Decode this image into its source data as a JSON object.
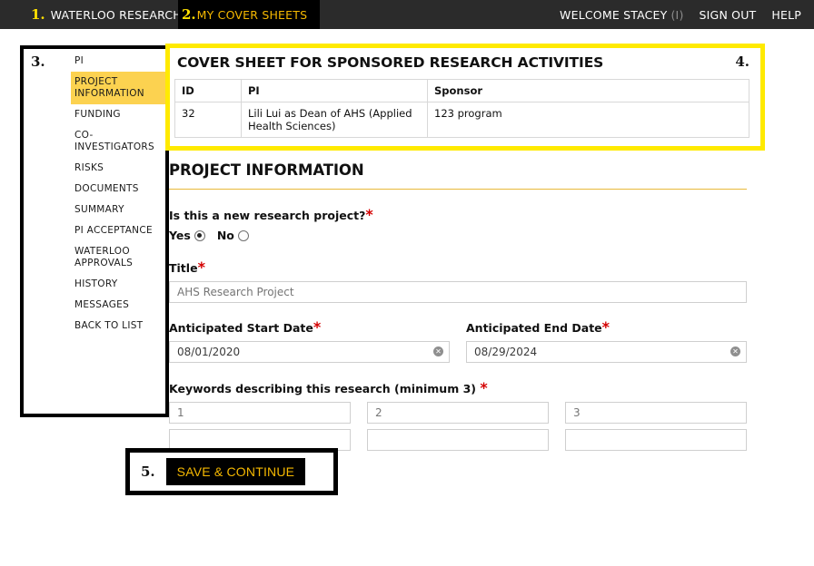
{
  "header": {
    "annotation_1": "1.",
    "brand": "WATERLOO RESEARCH",
    "annotation_2": "2.",
    "tab_cover_sheets": "MY COVER SHEETS",
    "welcome": "WELCOME STACEY",
    "welcome_initial": "(I)",
    "sign_out": "SIGN OUT",
    "help": "HELP"
  },
  "sidebar": {
    "annotation_3": "3.",
    "items": [
      {
        "label": "PI",
        "active": false
      },
      {
        "label": "PROJECT INFORMATION",
        "active": true
      },
      {
        "label": "FUNDING",
        "active": false
      },
      {
        "label": "CO-INVESTIGATORS",
        "active": false
      },
      {
        "label": "RISKS",
        "active": false
      },
      {
        "label": "DOCUMENTS",
        "active": false
      },
      {
        "label": "SUMMARY",
        "active": false
      },
      {
        "label": "PI ACCEPTANCE",
        "active": false
      },
      {
        "label": "WATERLOO APPROVALS",
        "active": false
      },
      {
        "label": "HISTORY",
        "active": false
      },
      {
        "label": "MESSAGES",
        "active": false
      },
      {
        "label": "BACK TO LIST",
        "active": false
      }
    ]
  },
  "cover_sheet": {
    "annotation_4": "4.",
    "title": "COVER SHEET FOR SPONSORED RESEARCH ACTIVITIES",
    "columns": [
      "ID",
      "PI",
      "Sponsor"
    ],
    "rows": [
      {
        "id": "32",
        "pi": "Lili Lui as Dean of AHS (Applied Health Sciences)",
        "sponsor": "123 program"
      }
    ]
  },
  "form": {
    "section_title": "PROJECT INFORMATION",
    "new_project": {
      "label": "Is this a new research project?",
      "required_mark": "*",
      "yes_label": "Yes",
      "no_label": "No",
      "selected": "Yes"
    },
    "title": {
      "label": "Title",
      "required_mark": "*",
      "value": "",
      "placeholder": "AHS Research Project"
    },
    "start_date": {
      "label": "Anticipated Start Date",
      "required_mark": "*",
      "value": "08/01/2020",
      "clear_icon": "✕"
    },
    "end_date": {
      "label": "Anticipated End Date",
      "required_mark": "*",
      "value": "08/29/2024",
      "clear_icon": "✕"
    },
    "keywords": {
      "label": "Keywords describing this research (minimum 3) ",
      "required_mark": "*",
      "row1": [
        {
          "value": "",
          "placeholder": "1"
        },
        {
          "value": "",
          "placeholder": "2"
        },
        {
          "value": "",
          "placeholder": "3"
        }
      ],
      "row2": [
        {
          "value": "",
          "placeholder": ""
        },
        {
          "value": "",
          "placeholder": ""
        },
        {
          "value": "",
          "placeholder": ""
        }
      ]
    }
  },
  "save": {
    "annotation_5": "5.",
    "label": "SAVE & CONTINUE"
  },
  "colors": {
    "header_bg": "#2b2b2b",
    "tab_bg": "#000000",
    "accent_gold": "#f5b800",
    "highlight_yellow": "#ffea00",
    "nav_active": "#fcd250",
    "required_red": "#d40000"
  }
}
